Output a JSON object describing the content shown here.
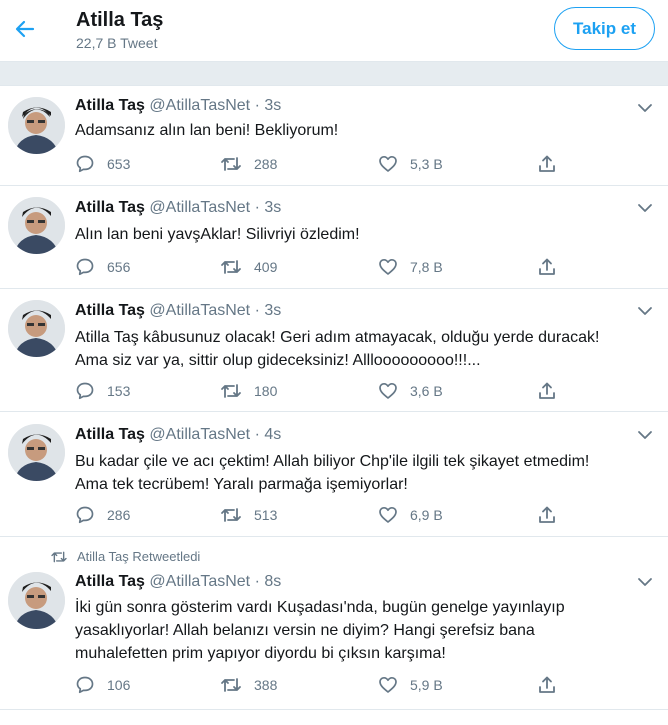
{
  "header": {
    "title": "Atilla Taş",
    "tweet_count": "22,7 B Tweet",
    "follow_label": "Takip et"
  },
  "tweets": [
    {
      "name": "Atilla Taş",
      "handle": "@AtillaTasNet",
      "dot": "·",
      "time": "3s",
      "text": "Adamsanız alın lan beni! Bekliyorum!",
      "replies": "653",
      "retweets": "288",
      "likes": "5,3 B"
    },
    {
      "name": "Atilla Taş",
      "handle": "@AtillaTasNet",
      "dot": "·",
      "time": "3s",
      "text": "Alın lan beni yavşAklar! Silivriyi özledim!",
      "replies": "656",
      "retweets": "409",
      "likes": "7,8 B"
    },
    {
      "name": "Atilla Taş",
      "handle": "@AtillaTasNet",
      "dot": "·",
      "time": "3s",
      "text_lines": [
        "Atilla Taş kâbusunuz olacak! Geri adım atmayacak, olduğu yerde duracak!",
        "Ama siz var ya, sittir olup gideceksiniz! Alllooooooooo!!!..."
      ],
      "replies": "153",
      "retweets": "180",
      "likes": "3,6 B"
    },
    {
      "name": "Atilla Taş",
      "handle": "@AtillaTasNet",
      "dot": "·",
      "time": "4s",
      "text_lines": [
        "Bu kadar çile ve acı çektim! Allah biliyor Chp'ile ilgili tek şikayet etmedim!",
        "Ama tek tecrübem! Yaralı parmağa işemiyorlar!"
      ],
      "replies": "286",
      "retweets": "513",
      "likes": "6,9 B"
    },
    {
      "retweeted_by": "Atilla Taş Retweetledi",
      "name": "Atilla Taş",
      "handle": "@AtillaTasNet",
      "dot": "·",
      "time": "8s",
      "text_lines": [
        "İki gün sonra gösterim vardı Kuşadası'nda, bugün genelge yayınlayıp",
        "yasaklıyorlar! Allah belanızı versin ne diyim? Hangi şerefsiz bana",
        "muhalefetten prim yapıyor diyordu bi çıksın karşıma!"
      ],
      "replies": "106",
      "retweets": "388",
      "likes": "5,9 B"
    }
  ],
  "icons": {
    "back": "back-arrow-icon",
    "caret": "chevron-down-icon",
    "reply": "reply-icon",
    "retweet": "retweet-icon",
    "like": "heart-icon",
    "share": "share-icon"
  },
  "colors": {
    "accent": "#1da1f2",
    "text": "#14171a",
    "muted": "#657786",
    "divider": "#e1e8ed",
    "gap": "#e6ecf0"
  }
}
